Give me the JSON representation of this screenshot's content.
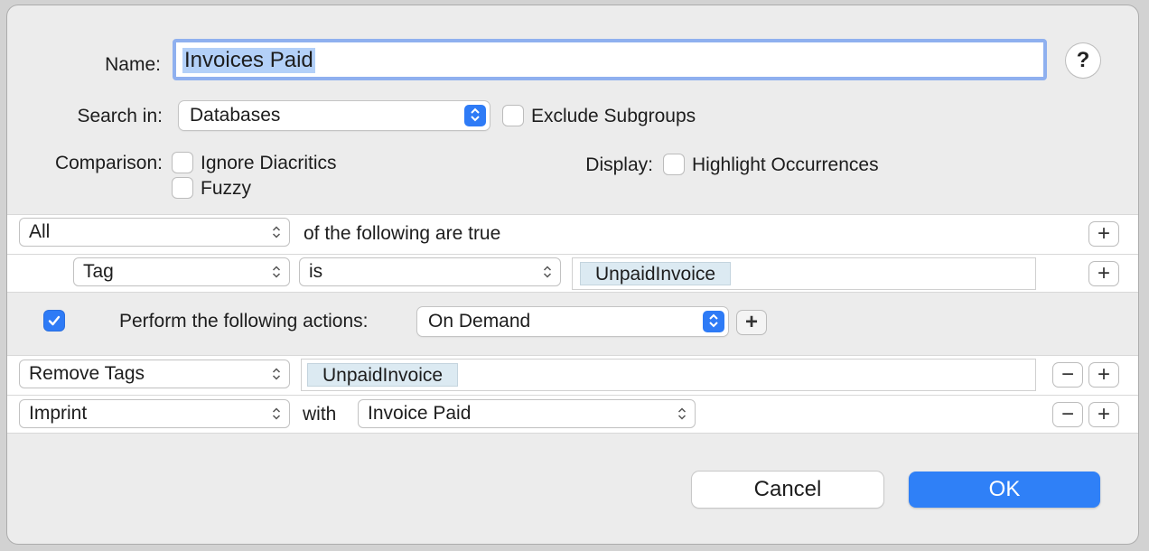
{
  "dialog": {
    "name_label": "Name:",
    "name_value": "Invoices Paid",
    "help_label": "?",
    "search_in_label": "Search in:",
    "search_in_value": "Databases",
    "exclude_subgroups_label": "Exclude Subgroups",
    "comparison_label": "Comparison:",
    "ignore_diacritics_label": "Ignore Diacritics",
    "fuzzy_label": "Fuzzy",
    "display_label": "Display:",
    "highlight_occurrences_label": "Highlight Occurrences"
  },
  "conditions": {
    "match_value": "All",
    "match_text": "of the following are true",
    "rows": [
      {
        "field": "Tag",
        "operator": "is",
        "tag": "UnpaidInvoice"
      }
    ]
  },
  "actions": {
    "enabled": true,
    "label": "Perform the following actions:",
    "trigger_value": "On Demand",
    "rows": [
      {
        "action": "Remove Tags",
        "tag": "UnpaidInvoice"
      },
      {
        "action": "Imprint",
        "with_label": "with",
        "value": "Invoice Paid"
      }
    ]
  },
  "buttons": {
    "plus": "+",
    "minus": "−",
    "cancel": "Cancel",
    "ok": "OK"
  },
  "colors": {
    "accent": "#2f80f7",
    "selection": "#b3d0f8",
    "focus_ring": "#8fb0ef",
    "tag_token": "#dceaf2"
  }
}
